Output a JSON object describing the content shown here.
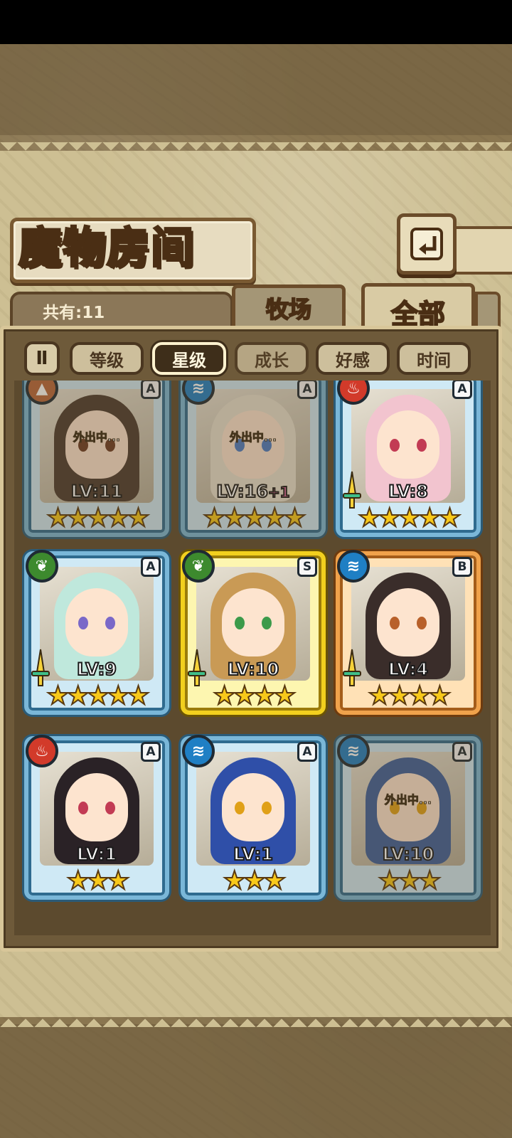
{
  "screen": {
    "title": "魔物房间",
    "total_label": "共有:11",
    "tabs": [
      {
        "label": "牧场",
        "active": false
      },
      {
        "label": "全部",
        "active": true
      }
    ],
    "sort_toggle_label": "Ⅱ",
    "sort_buttons": [
      {
        "label": "等级",
        "active": false
      },
      {
        "label": "星级",
        "active": true
      },
      {
        "label": "成长",
        "active": false
      },
      {
        "label": "好感",
        "active": false
      },
      {
        "label": "时间",
        "active": false
      }
    ],
    "back_icon": "back-arrow-icon"
  },
  "monsters": [
    {
      "element": "earth",
      "rank": "A",
      "level": "LV:11",
      "bonus": "",
      "stars": "★★★★★",
      "away": true,
      "away_label": "外出中...",
      "equipped": false
    },
    {
      "element": "water",
      "rank": "A",
      "level": "LV:16",
      "bonus": "+1",
      "stars": "★★★★★",
      "away": true,
      "away_label": "外出中...",
      "equipped": false
    },
    {
      "element": "fire",
      "rank": "A",
      "level": "LV:8",
      "bonus": "",
      "stars": "★★★★★",
      "away": false,
      "away_label": "",
      "equipped": true
    },
    {
      "element": "leaf",
      "rank": "A",
      "level": "LV:9",
      "bonus": "",
      "stars": "★★★★★",
      "away": false,
      "away_label": "",
      "equipped": true
    },
    {
      "element": "leaf",
      "rank": "S",
      "level": "LV:10",
      "bonus": "",
      "stars": "★★★★",
      "away": false,
      "away_label": "",
      "equipped": true
    },
    {
      "element": "water",
      "rank": "B",
      "level": "LV:4",
      "bonus": "",
      "stars": "★★★★",
      "away": false,
      "away_label": "",
      "equipped": true
    },
    {
      "element": "fire",
      "rank": "A",
      "level": "LV:1",
      "bonus": "",
      "stars": "★★★",
      "away": false,
      "away_label": "",
      "equipped": false
    },
    {
      "element": "water",
      "rank": "A",
      "level": "LV:1",
      "bonus": "",
      "stars": "★★★",
      "away": false,
      "away_label": "",
      "equipped": false
    },
    {
      "element": "water",
      "rank": "A",
      "level": "LV:10",
      "bonus": "",
      "stars": "★★★",
      "away": true,
      "away_label": "外出中...",
      "equipped": false
    }
  ],
  "colors": {
    "water": "#1f7fc4",
    "fire": "#d23a2a",
    "leaf": "#3d8a2e",
    "earth": "#b9673b",
    "star": "#f8c91a"
  }
}
